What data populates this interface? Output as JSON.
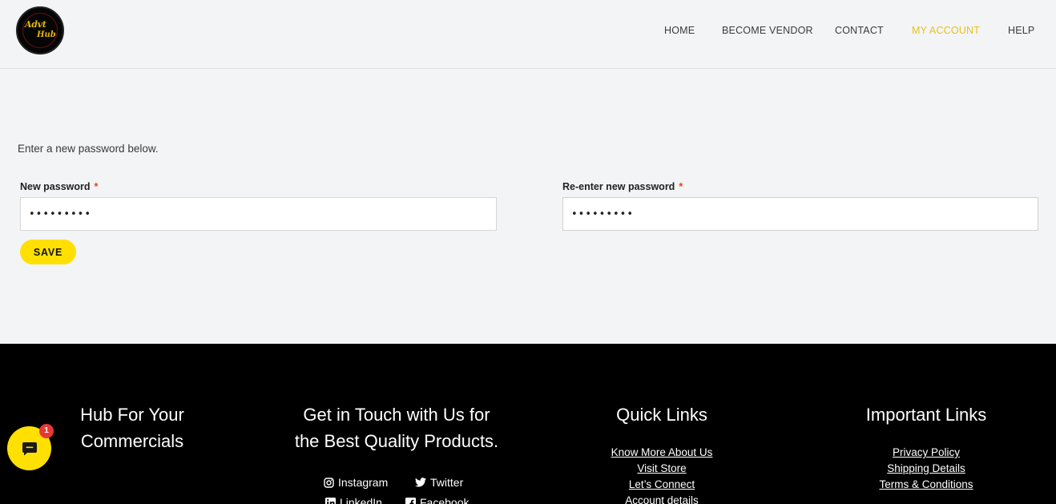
{
  "logo": {
    "line1": "Advt",
    "line2": "Hub"
  },
  "nav": [
    {
      "label": "HOME"
    },
    {
      "label": "BECOME VENDOR"
    },
    {
      "label": "CONTACT"
    },
    {
      "label": "MY ACCOUNT",
      "active": true
    },
    {
      "label": "HELP"
    }
  ],
  "form": {
    "intro": "Enter a new password below.",
    "new_password_label": "New password",
    "confirm_password_label": "Re-enter new password",
    "required_mark": "*",
    "new_password_value": "•••••••••",
    "confirm_password_value": "•••••••••",
    "save_label": "SAVE"
  },
  "footer": {
    "col1_heading_line1": "Hub For Your",
    "col1_heading_line2": "Commercials",
    "col2_heading_line1": "Get in Touch with Us for",
    "col2_heading_line2": "the Best Quality Products.",
    "social": [
      {
        "label": "Instagram",
        "icon": "instagram-icon"
      },
      {
        "label": "Twitter",
        "icon": "twitter-icon"
      },
      {
        "label": "LinkedIn",
        "icon": "linkedin-icon"
      },
      {
        "label": "Facebook",
        "icon": "facebook-icon"
      }
    ],
    "quick_links_heading": "Quick Links",
    "quick_links": [
      "Know More About Us",
      "Visit Store",
      "Let’s Connect",
      "Account details"
    ],
    "important_links_heading": "Important Links",
    "important_links": [
      "Privacy Policy",
      "Shipping Details",
      "Terms & Conditions"
    ]
  },
  "chat": {
    "badge": "1",
    "icon": "chat-bubble-icon"
  },
  "colors": {
    "accent": "#ffe000",
    "nav_active": "#e9c21c",
    "footer_bg": "#000000",
    "page_bg": "#f3f4f6"
  }
}
